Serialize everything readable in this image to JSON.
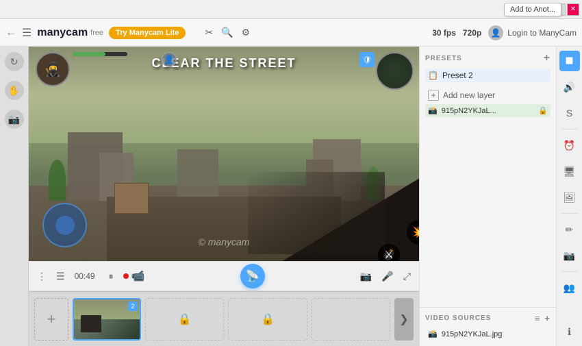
{
  "titlebar": {
    "tooltip": "Add to Anot..."
  },
  "toolbar": {
    "brand_name": "manycam",
    "brand_free": "free",
    "try_btn": "Try Manycam Lite",
    "fps": "30 fps",
    "resolution": "720p",
    "login_text": "Login to ManyCam"
  },
  "video": {
    "mission_text": "Clear THE STREET",
    "watermark": "© manycam",
    "time": "00:49"
  },
  "presets": {
    "section_title": "PRESETS",
    "preset_name": "Preset 2",
    "add_layer_text": "Add new layer",
    "layer_name": "915pN2YKJaL..."
  },
  "video_sources": {
    "section_title": "VIDEO SOURCES",
    "source_name": "915pN2YKJaL.jpg"
  },
  "controls": {
    "broadcast_icon": "📡",
    "camera_icon": "📷",
    "mic_icon": "🎤",
    "expand_icon": "⛶"
  },
  "layers": {
    "add_icon": "+",
    "lock_icon": "🔒",
    "arrow_icon": "❯",
    "badge": "2"
  }
}
